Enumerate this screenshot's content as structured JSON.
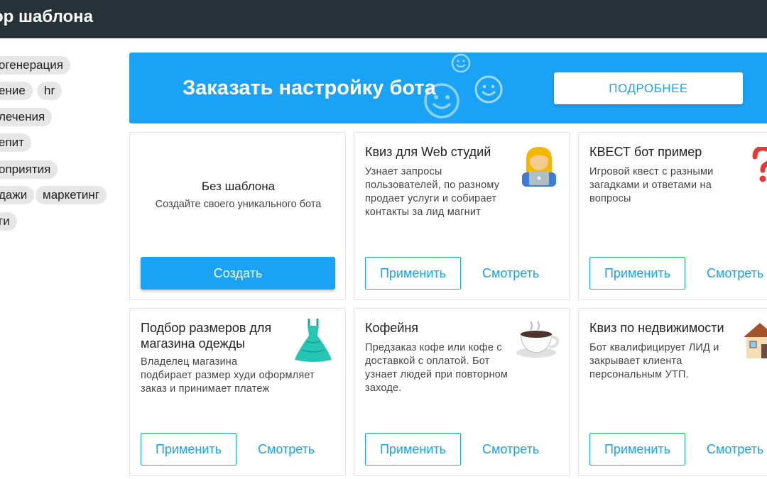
{
  "header": {
    "title": "ор шаблона"
  },
  "tags": [
    {
      "label": "огенерация"
    },
    {
      "label": "ение"
    },
    {
      "label": "hr"
    },
    {
      "label": "лечения"
    },
    {
      "label": "епит"
    },
    {
      "label": "оприятия"
    },
    {
      "label": "дажи"
    },
    {
      "label": "маркетинг"
    },
    {
      "label": "ги"
    }
  ],
  "banner": {
    "text": "Заказать настройку бота",
    "button_label": "ПОДРОБНЕЕ",
    "color": "#1aa3f5"
  },
  "blank_card": {
    "title": "Без шаблона",
    "description": "Создайте своего уникального бота",
    "button_label": "Создать"
  },
  "templates": [
    {
      "title": "Квиз для Web студий",
      "description": [
        "Узнает запросы",
        "пользователей, по разному",
        "продает услуги и собирает",
        "контакты за лид магнит"
      ],
      "icon": "technologist-icon",
      "apply_label": "Применить",
      "view_label": "Смотреть"
    },
    {
      "title": "КВЕСТ бот пример",
      "description": [
        "Игровой квест с разными",
        "загадками и ответами на",
        "вопросы"
      ],
      "icon": "question-mark-icon",
      "apply_label": "Применить",
      "view_label": "Смотреть"
    },
    {
      "title": [
        "Подбор размеров для",
        "магазина одежды"
      ],
      "description": [
        "Владелец магазина",
        "подбирает размер худи оформляет",
        "заказ и принимает платеж"
      ],
      "icon": "dress-icon",
      "apply_label": "Применить",
      "view_label": "Смотреть"
    },
    {
      "title": "Кофейня",
      "description": [
        "Предзаказ кофе или кофе с",
        "доставкой с оплатой. Бот",
        "узнает людей при повторном",
        "заходе."
      ],
      "icon": "coffee-cup-icon",
      "apply_label": "Применить",
      "view_label": "Смотреть"
    },
    {
      "title": "Квиз по недвижимости",
      "description": [
        "Бот квалифицирует ЛИД и",
        "закрывает клиента",
        "персональным УТП."
      ],
      "icon": "house-icon",
      "apply_label": "Применить",
      "view_label": "Смотреть"
    }
  ],
  "colors": {
    "accent": "#1aa3f5",
    "header_bg": "#263238",
    "tag_bg": "#e6e6e6"
  }
}
